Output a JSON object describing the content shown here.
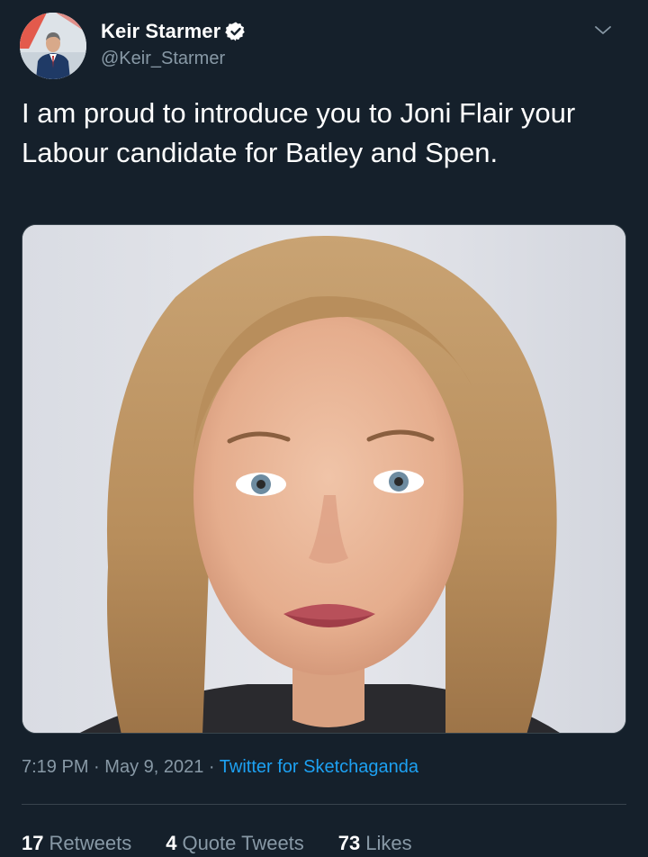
{
  "tweet": {
    "author": {
      "display_name": "Keir Starmer",
      "handle": "@Keir_Starmer",
      "verified": true,
      "avatar": "profile-photo"
    },
    "text": "I am proud to introduce you to Joni Flair your Labour candidate for Batley and Spen.",
    "media": "portrait-photo",
    "time": "7:19 PM",
    "date": "May 9, 2021",
    "separator": "·",
    "source": "Twitter for Sketchaganda",
    "stats": {
      "retweets": {
        "count": "17",
        "label": "Retweets"
      },
      "quote_tweets": {
        "count": "4",
        "label": "Quote Tweets"
      },
      "likes": {
        "count": "73",
        "label": "Likes"
      }
    }
  },
  "icons": {
    "verified": "verified-badge-icon",
    "menu": "chevron-down-icon"
  },
  "colors": {
    "background": "#15202b",
    "text_primary": "#ffffff",
    "text_secondary": "#8899a6",
    "link": "#1da1f2",
    "divider": "#38444d"
  }
}
